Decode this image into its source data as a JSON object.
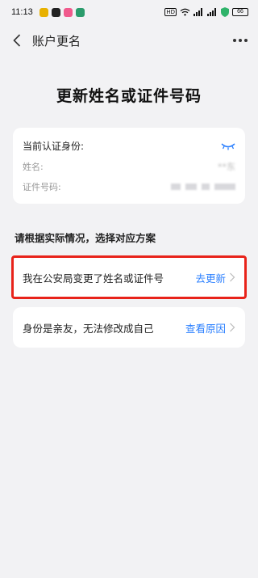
{
  "status_bar": {
    "time": "11:13",
    "hd": "HD",
    "battery": "66"
  },
  "nav": {
    "title": "账户更名"
  },
  "page": {
    "title": "更新姓名或证件号码"
  },
  "identity": {
    "header": "当前认证身份:",
    "name_label": "姓名:",
    "name_value": "**东",
    "id_label": "证件号码:"
  },
  "section_label": "请根据实际情况，选择对应方案",
  "options": [
    {
      "text": "我在公安局变更了姓名或证件号",
      "action": "去更新"
    },
    {
      "text": "身份是亲友，无法修改成自己",
      "action": "查看原因"
    }
  ],
  "colors": {
    "accent": "#2a7fff",
    "highlight": "#e8231a",
    "background": "#f2f2f4"
  }
}
